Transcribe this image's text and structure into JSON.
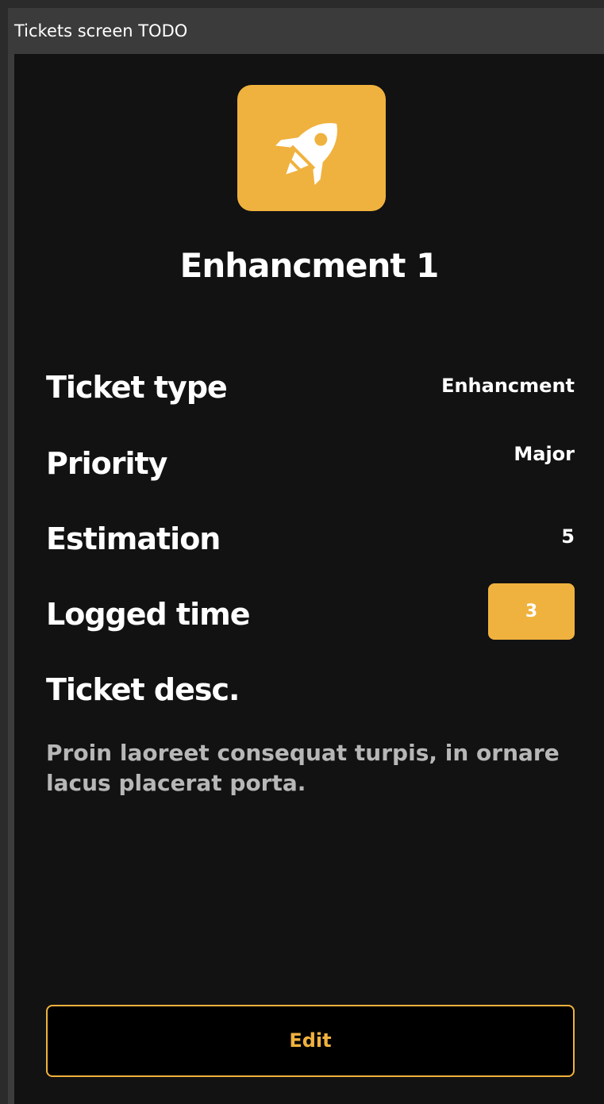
{
  "window": {
    "title": "Tickets screen TODO"
  },
  "ticket": {
    "icon": "rocket-icon",
    "accent_color": "#f0b23e",
    "title": "Enhancment 1",
    "fields": {
      "type_label": "Ticket type",
      "type_value": "Enhancment",
      "priority_label": "Priority",
      "priority_value": "Major",
      "estimation_label": "Estimation",
      "estimation_value": "5",
      "logged_label": "Logged time",
      "logged_value": "3"
    },
    "desc_label": "Ticket desc.",
    "description": "Proin laoreet consequat turpis, in ornare lacus placerat porta."
  },
  "actions": {
    "edit_label": "Edit"
  }
}
